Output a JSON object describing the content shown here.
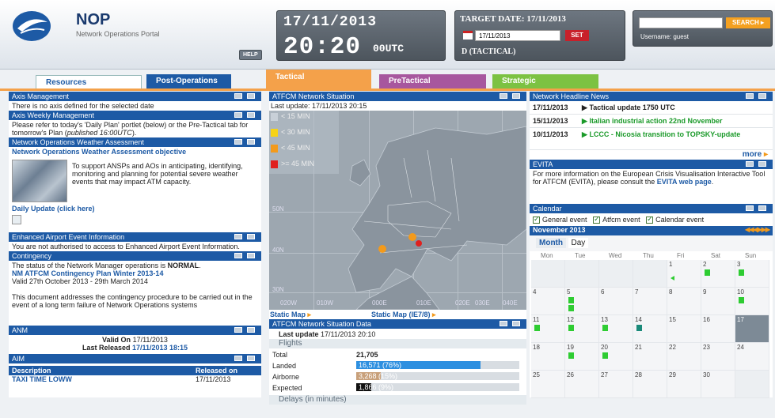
{
  "header": {
    "app_title": "NOP",
    "app_subtitle": "Network Operations Portal",
    "help_label": "HELP",
    "clock_date": "17/11/2013",
    "clock_time": "20:20",
    "clock_seconds": "00UTC",
    "target_title": "TARGET DATE: 17/11/2013",
    "target_input": "17/11/2013",
    "set_label": "SET",
    "target_mode": "D (TACTICAL)",
    "search_label": "SEARCH",
    "username": "Username: guest"
  },
  "tabs": [
    "Resources",
    "Post-Operations",
    "Tactical",
    "PreTactical",
    "Strategic"
  ],
  "left": {
    "axis_mgmt_title": "Axis Management",
    "axis_mgmt_text": "There is no axis defined for the selected date",
    "axis_weekly_title": "Axis Weekly Management",
    "axis_weekly_text": "Please refer to today's 'Daily Plan' portlet (below) or the Pre-Tactical tab for tomorrow's Plan (",
    "axis_weekly_italic": "published 16:00UTC",
    "axis_weekly_end": ").",
    "weather_title": "Network Operations Weather Assessment",
    "weather_link": "Network Operations Weather Assessment objective",
    "weather_text": "To support ANSPs and AOs in anticipating, identifying, monitoring and planning for potential severe weather events that may impact ATM capacity.",
    "daily_update": "Daily Update (click here)",
    "airport_title": "Enhanced Airport Event Information",
    "airport_text": "You are not authorised to access to Enhanced Airport Event Information.",
    "contingency_title": "Contingency",
    "contingency_text": "The status of the Network Manager operations is ",
    "contingency_status": "NORMAL",
    "contingency_link": "NM ATFCM Contingency Plan Winter 2013-14",
    "contingency_valid": "Valid 27th October 2013 - 29th March 2014",
    "contingency_desc": "This document addresses the contingency procedure to be carried out in the event of a long term failure of Network Operations systems",
    "anm_title": "ANM",
    "anm_valid_label": "Valid On",
    "anm_valid_value": "17/11/2013",
    "anm_released_label": "Last Released",
    "anm_released_value": "17/11/2013 18:15",
    "aim_title": "AIM",
    "aim_col1": "Description",
    "aim_col2": "Released on",
    "aim_row1_desc": "TAXI TIME LOWW",
    "aim_row1_date": "17/11/2013"
  },
  "middle": {
    "situation_title": "ATFCM Network Situation",
    "last_update": "Last update: 17/11/2013 20:15",
    "legend": [
      {
        "label": "< 15 MIN",
        "color": "#c8d0d8"
      },
      {
        "label": "< 30 MIN",
        "color": "#f6d316"
      },
      {
        "label": "< 45 MIN",
        "color": "#f39a1b"
      },
      {
        "label": ">= 45 MIN",
        "color": "#e0201e"
      }
    ],
    "lat_labels": [
      "50N",
      "40N",
      "30N"
    ],
    "lon_labels": [
      "020W",
      "010W",
      "000E",
      "010E",
      "020E",
      "030E",
      "040E"
    ],
    "static_map": "Static Map",
    "static_map_ie": "Static Map (IE7/8)",
    "data_title": "ATFCM Network Situation Data",
    "data_update_label": "Last update",
    "data_update_value": "17/11/2013 20:10",
    "flights_label": "Flights",
    "total_label": "Total",
    "total_value": "21,705",
    "landed_label": "Landed",
    "landed_value": "16,571 (76%)",
    "landed_pct": 76,
    "airborne_label": "Airborne",
    "airborne_value": "3,268 (15%)",
    "airborne_pct": 15,
    "expected_label": "Expected",
    "expected_value": "1,866 (9%)",
    "expected_pct": 9,
    "delays_label": "Delays (in minutes)"
  },
  "right": {
    "news_title": "Network Headline News",
    "news": [
      {
        "date": "17/11/2013",
        "text": "Tactical update 1750 UTC",
        "color": "#111"
      },
      {
        "date": "15/11/2013",
        "text": "Italian industrial action 22nd November",
        "color": "#1b9a2a"
      },
      {
        "date": "10/11/2013",
        "text": "LCCC - Nicosia transition to TOPSKY-update",
        "color": "#1b9a2a"
      }
    ],
    "more": "more",
    "evita_title": "EVITA",
    "evita_text": "For more information on the European Crisis Visualisation Interactive Tool for ATFCM (EVITA), please consult the ",
    "evita_link": "EVITA web page",
    "calendar_title": "Calendar",
    "chk_general": "General event",
    "chk_atfcm": "Atfcm event",
    "chk_calendar": "Calendar event",
    "month_label": "November 2013",
    "view_month": "Month",
    "view_day": "Day",
    "weekdays": [
      "Mon",
      "Tue",
      "Wed",
      "Thu",
      "Fri",
      "Sat",
      "Sun"
    ],
    "days": [
      "",
      "",
      "",
      "",
      "1",
      "2",
      "3",
      "4",
      "5",
      "6",
      "7",
      "8",
      "9",
      "10",
      "11",
      "12",
      "13",
      "14",
      "15",
      "16",
      "17",
      "18",
      "19",
      "20",
      "21",
      "22",
      "23",
      "24",
      "25",
      "26",
      "27",
      "28",
      "29",
      "30",
      ""
    ]
  }
}
